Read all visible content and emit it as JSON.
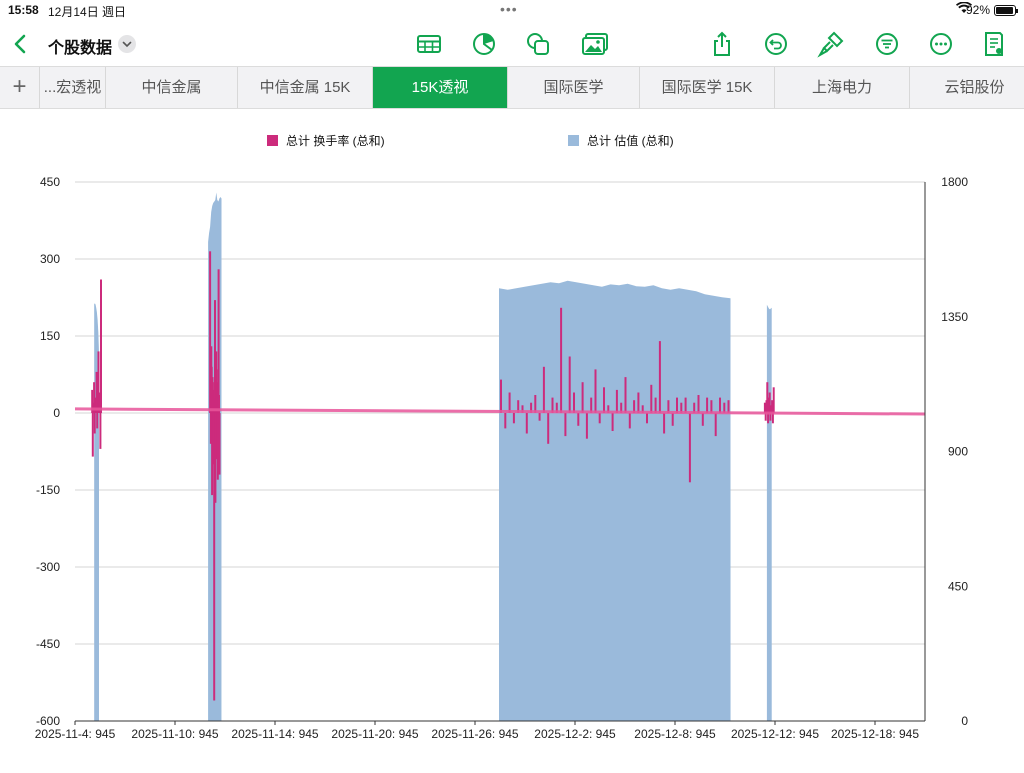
{
  "status_bar": {
    "time": "15:58",
    "date": "12月14日 週日",
    "battery": "92%"
  },
  "header": {
    "back_icon": "chevron-left-icon",
    "title": "个股数据"
  },
  "toolbar": {
    "accent": "#12a550",
    "icons": [
      "table-icon",
      "pie-chart-icon",
      "shapes-icon",
      "media-icon",
      "share-icon",
      "undo-icon",
      "format-brush-icon",
      "filter-icon",
      "more-icon",
      "document-view-icon"
    ]
  },
  "tabs": [
    {
      "label": "...宏透视",
      "active": false
    },
    {
      "label": "中信金属",
      "active": false
    },
    {
      "label": "中信金属 15K",
      "active": false
    },
    {
      "label": "15K透视",
      "active": true
    },
    {
      "label": "国际医学",
      "active": false
    },
    {
      "label": "国际医学 15K",
      "active": false
    },
    {
      "label": "上海电力",
      "active": false
    },
    {
      "label": "云铝股份",
      "active": false
    }
  ],
  "chart_data": {
    "type": "bar+area",
    "legend": [
      {
        "name": "总计 换手率 (总和)",
        "color": "#cc2b7c"
      },
      {
        "name": "总计 估值 (总和)",
        "color": "#9abadb"
      }
    ],
    "left_axis": {
      "ticks": [
        "450",
        "300",
        "150",
        "0",
        "-150",
        "-300",
        "-450",
        "-600"
      ],
      "range": [
        -600,
        450
      ]
    },
    "right_axis": {
      "ticks": [
        "1800",
        "1350",
        "900",
        "450",
        "0"
      ],
      "range": [
        0,
        1800
      ]
    },
    "x_tick_labels": [
      "2025-11-4: 945",
      "2025-11-10: 945",
      "2025-11-14: 945",
      "2025-11-20: 945",
      "2025-11-26: 945",
      "2025-12-2: 945",
      "2025-12-8: 945",
      "2025-12-12: 945",
      "2025-12-18: 945"
    ],
    "valuation_segments": [
      {
        "start": "2025-11-4",
        "end": "2025-11-5",
        "values": [
          1230,
          1300,
          1340,
          1365,
          1380,
          1390,
          1395,
          1392
        ]
      },
      {
        "start": "2025-11-10",
        "end": "2025-11-12",
        "values": [
          1600,
          1630,
          1650,
          1700,
          1720,
          1730,
          1735,
          1740,
          1765,
          1740,
          1735,
          1745,
          1750,
          1745
        ]
      },
      {
        "start": "2025-11-26",
        "end": "2025-12-10",
        "values": [
          1445,
          1440,
          1445,
          1450,
          1455,
          1460,
          1465,
          1462,
          1470,
          1465,
          1460,
          1455,
          1450,
          1458,
          1455,
          1460,
          1452,
          1450,
          1455,
          1445,
          1440,
          1445,
          1440,
          1435,
          1425,
          1420,
          1415,
          1412
        ]
      },
      {
        "start": "2025-12-11",
        "end": "2025-12-12",
        "values": [
          1380,
          1378,
          1375,
          1376,
          1380,
          1385,
          1390
        ]
      }
    ],
    "turnover_segments": [
      {
        "start": "2025-11-4",
        "end": "2025-11-5",
        "values": [
          260,
          -70,
          40,
          10,
          120,
          55,
          -30,
          80,
          30,
          15,
          -40,
          60,
          20,
          -85,
          45
        ]
      },
      {
        "start": "2025-11-10",
        "end": "2025-11-12",
        "values": [
          315,
          30,
          -60,
          130,
          90,
          -160,
          70,
          40,
          -100,
          45,
          -560,
          60,
          220,
          -175,
          30,
          120,
          85,
          -90,
          60,
          -130,
          40,
          280,
          35,
          -120
        ]
      },
      {
        "start": "2025-11-26",
        "end": "2025-12-10",
        "values": [
          65,
          -30,
          40,
          -20,
          25,
          15,
          -40,
          20,
          35,
          -15,
          90,
          -60,
          30,
          20,
          205,
          -45,
          110,
          40,
          -25,
          60,
          -50,
          30,
          85,
          -20,
          50,
          15,
          -35,
          45,
          20,
          70,
          -30,
          25,
          40,
          15,
          -20,
          55,
          30,
          140,
          -40,
          25,
          -25,
          30,
          20,
          30,
          -135,
          20,
          35,
          -25,
          30,
          25,
          -45,
          30,
          20,
          25
        ]
      },
      {
        "start": "2025-12-11",
        "end": "2025-12-12",
        "values": [
          50,
          -20,
          25,
          15,
          -15,
          40,
          30,
          -20,
          60,
          25,
          -15,
          20
        ]
      }
    ],
    "trendline": {
      "color": "#e8559a",
      "start_value": 8,
      "end_value": -2
    },
    "grid": true
  }
}
